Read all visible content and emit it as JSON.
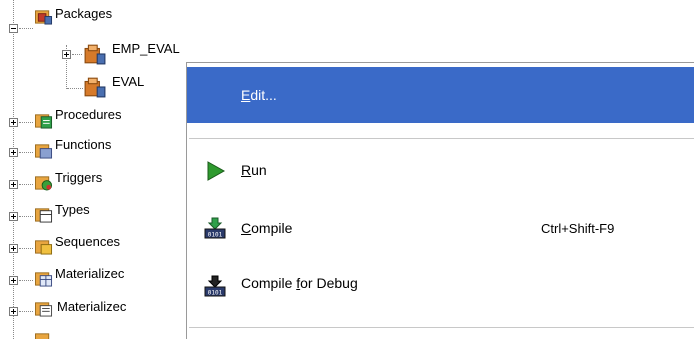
{
  "tree": {
    "packages": {
      "label": "Packages"
    },
    "emp_eval": {
      "label": "EMP_EVAL"
    },
    "eval": {
      "label": "EVAL"
    },
    "procedures": {
      "label": "Procedures"
    },
    "functions": {
      "label": "Functions"
    },
    "triggers": {
      "label": "Triggers"
    },
    "types": {
      "label": "Types"
    },
    "sequences": {
      "label": "Sequences"
    },
    "materialized1": {
      "label": "Materializec"
    },
    "materialized2": {
      "label": "Materializec"
    }
  },
  "menu": {
    "edit": {
      "mnemonic": "E",
      "rest": "dit..."
    },
    "run": {
      "mnemonic": "R",
      "rest": "un"
    },
    "compile": {
      "mnemonic": "C",
      "rest": "ompile",
      "shortcut": "Ctrl+Shift-F9"
    },
    "compile_debug": {
      "before": "Compile ",
      "mnemonic": "f",
      "rest": "or Debug"
    }
  },
  "colors": {
    "selection": "#3a6ac8",
    "folder": "#e8a540",
    "run_arrow": "#2e9a2e"
  }
}
